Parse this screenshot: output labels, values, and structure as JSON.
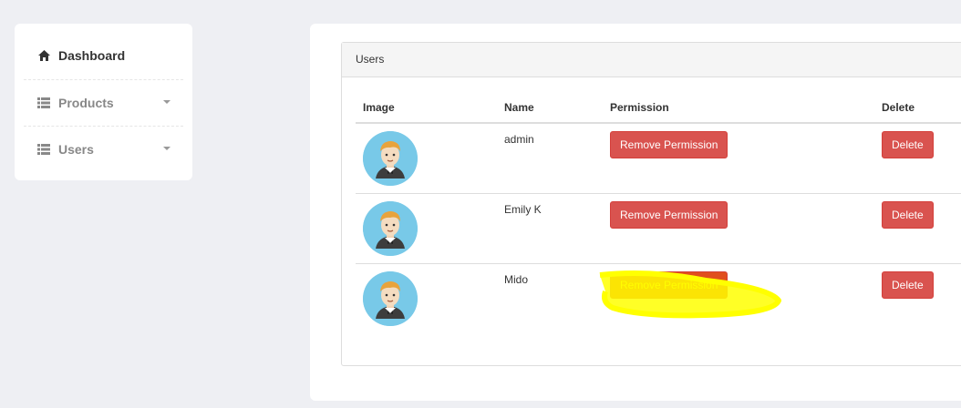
{
  "sidebar": {
    "items": [
      {
        "label": "Dashboard",
        "icon": "home-icon",
        "active": true
      },
      {
        "label": "Products",
        "icon": "list-icon",
        "has_dropdown": true
      },
      {
        "label": "Users",
        "icon": "list-icon",
        "has_dropdown": true
      }
    ]
  },
  "panel": {
    "title": "Users",
    "columns": [
      "Image",
      "Name",
      "Permission",
      "Delete"
    ],
    "rows": [
      {
        "name": "admin",
        "permission_label": "Remove Permission",
        "delete_label": "Delete"
      },
      {
        "name": "Emily K",
        "permission_label": "Remove Permission",
        "delete_label": "Delete"
      },
      {
        "name": "Mido",
        "permission_label": "Remove Permission",
        "delete_label": "Delete",
        "highlighted": true
      }
    ]
  },
  "colors": {
    "danger": "#d9534f",
    "highlight": "#ffff00",
    "avatar_bg": "#78c9e8",
    "background": "#eeeff3"
  }
}
